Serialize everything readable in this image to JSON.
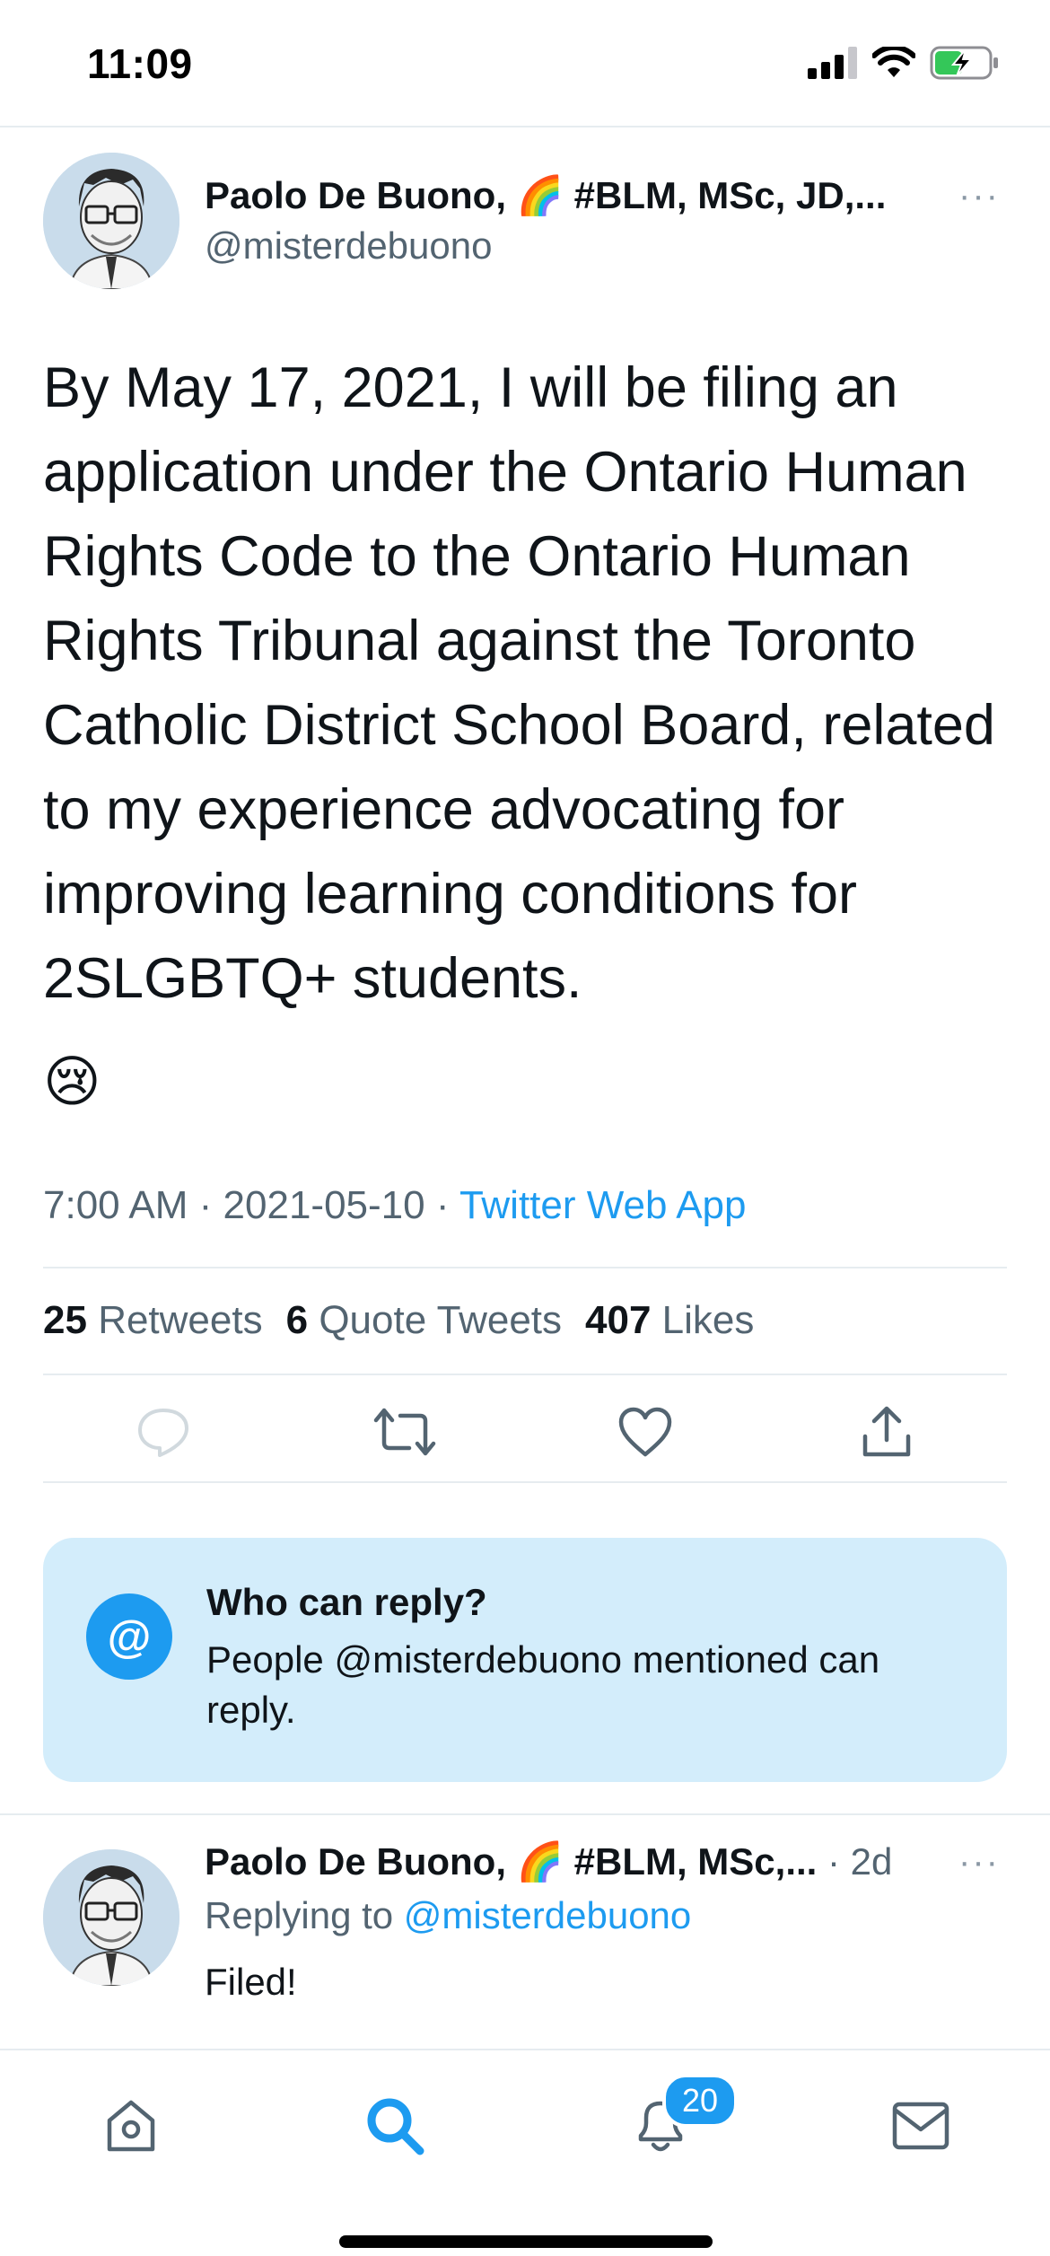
{
  "status_bar": {
    "time": "11:09"
  },
  "tweet": {
    "author_name": "Paolo De Buono, 🌈 #BLM, MSc, JD,...",
    "handle": "@misterdebuono",
    "more": "···",
    "text": "By May 17, 2021, I will be filing an application under the Ontario Human Rights Code to the Ontario Human Rights Tribunal against the Toronto Catholic District School Board, related to my experience advocating for improving learning conditions for 2SLGBTQ+ students.",
    "emoji": "😢",
    "time": "7:00 AM",
    "date": "2021-05-10",
    "separator": " · ",
    "source": "Twitter Web App",
    "stats": {
      "retweets_count": "25",
      "retweets_label": "Retweets",
      "quotes_count": "6",
      "quotes_label": "Quote Tweets",
      "likes_count": "407",
      "likes_label": "Likes"
    }
  },
  "who_can_reply": {
    "icon": "@",
    "title": "Who can reply?",
    "body": "People @misterdebuono mentioned can reply."
  },
  "reply": {
    "author_name": "Paolo De Buono, 🌈 #BLM, MSc,...",
    "time": " · 2d",
    "more": "···",
    "replying_to_label": "Replying to ",
    "replying_to_handle": "@misterdebuono",
    "text": "Filed!"
  },
  "tab_bar": {
    "notifications_badge": "20",
    "active_tab": "search",
    "accent_color": "#1d9bf0"
  },
  "colors": {
    "accent": "#1d9bf0",
    "secondary_text": "#536471",
    "reply_box_bg": "#d3edfb"
  }
}
